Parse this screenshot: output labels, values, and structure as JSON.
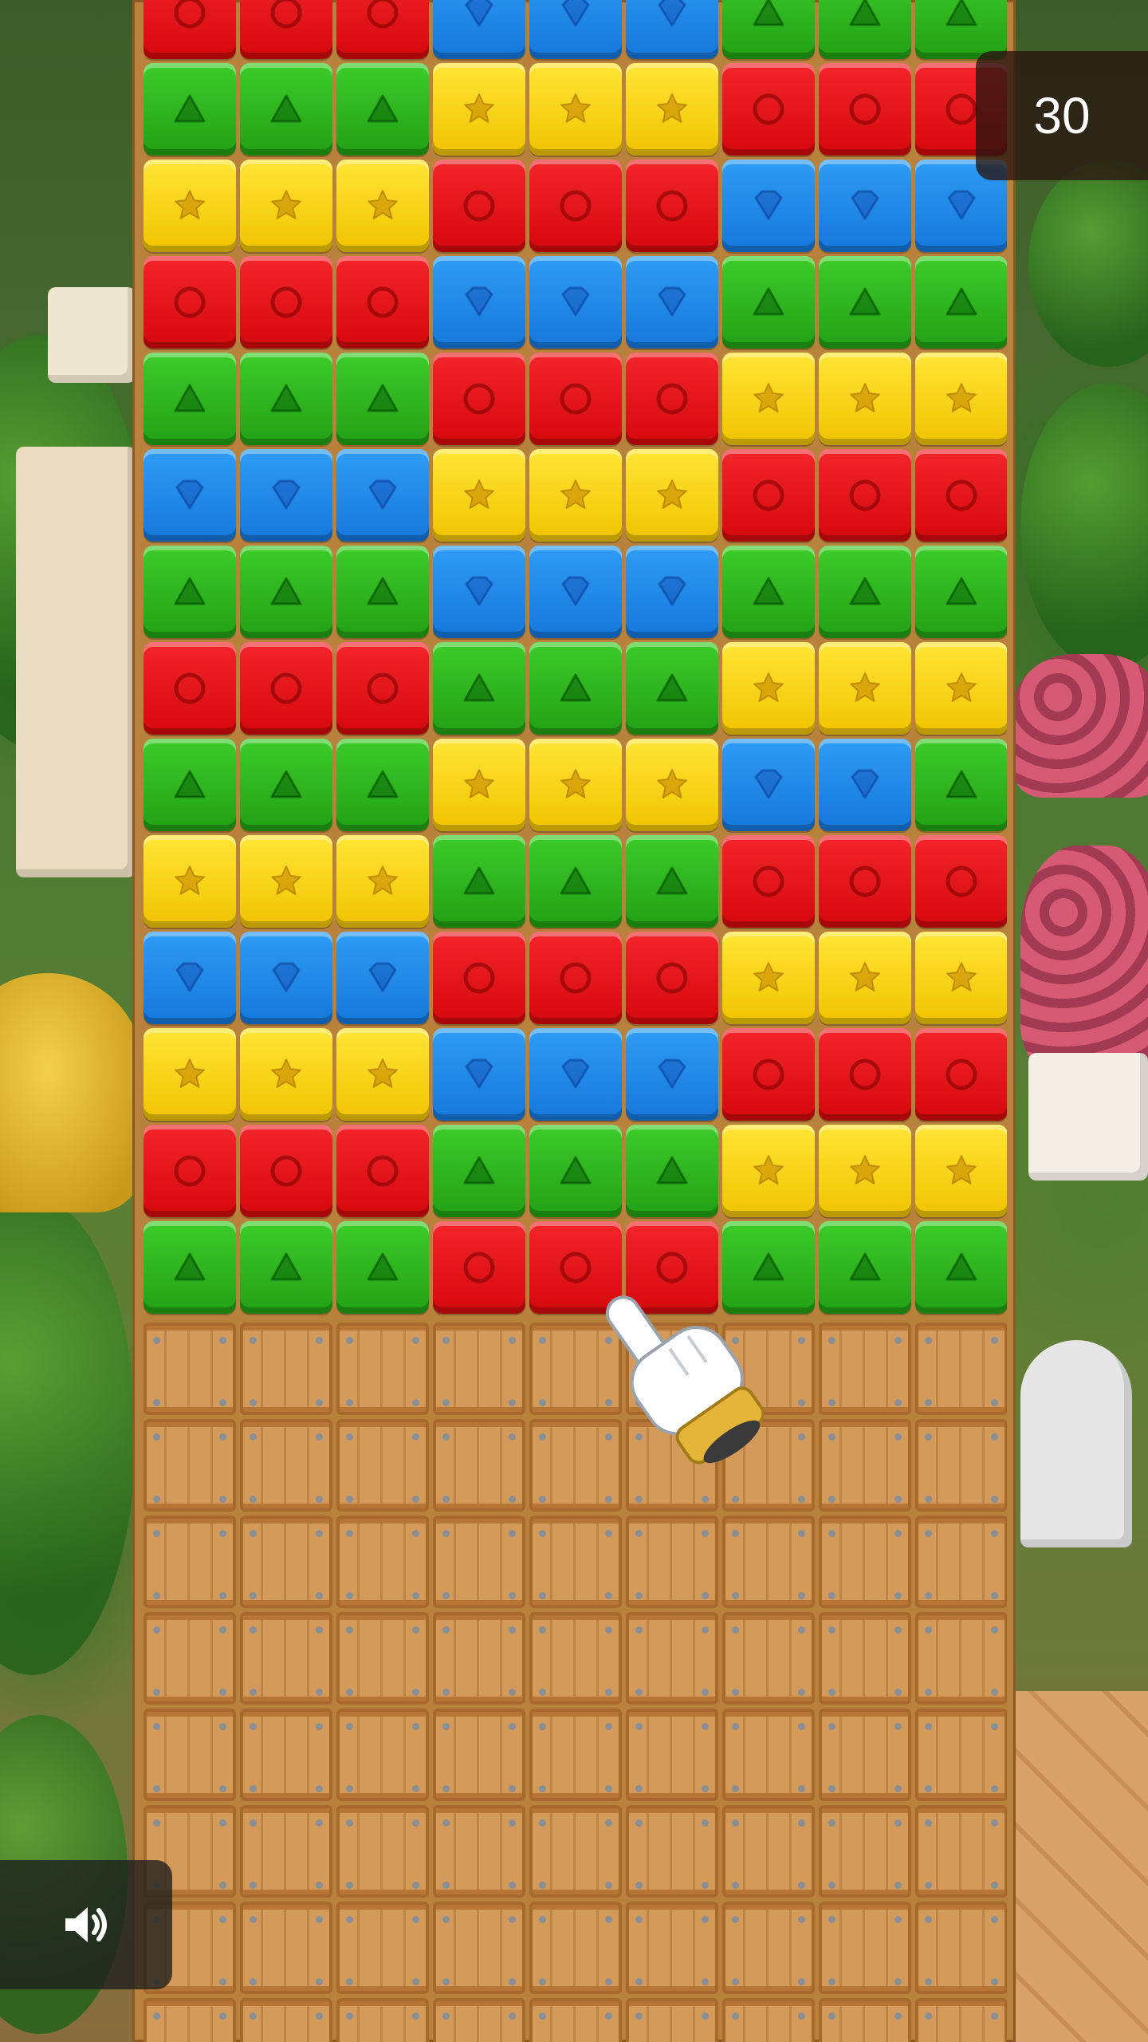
{
  "game": {
    "moves_left": "30",
    "sound_icon": "speaker-on-icon",
    "tutorial_icon": "pointing-hand-icon",
    "colors": {
      "red": "#e01519",
      "green": "#2fb51f",
      "yellow": "#fbd515",
      "blue": "#2186e8"
    },
    "symbols": {
      "red": "circle",
      "green": "triangle",
      "yellow": "star",
      "blue": "diamond"
    }
  },
  "board": {
    "columns": 9,
    "cube_rows": [
      [
        "R",
        "R",
        "R",
        "B",
        "B",
        "B",
        "G",
        "G",
        "G"
      ],
      [
        "G",
        "G",
        "G",
        "Y",
        "Y",
        "Y",
        "R",
        "R",
        "R"
      ],
      [
        "Y",
        "Y",
        "Y",
        "R",
        "R",
        "R",
        "B",
        "B",
        "B"
      ],
      [
        "R",
        "R",
        "R",
        "B",
        "B",
        "B",
        "G",
        "G",
        "G"
      ],
      [
        "G",
        "G",
        "G",
        "R",
        "R",
        "R",
        "Y",
        "Y",
        "Y"
      ],
      [
        "B",
        "B",
        "B",
        "Y",
        "Y",
        "Y",
        "R",
        "R",
        "R"
      ],
      [
        "G",
        "G",
        "G",
        "B",
        "B",
        "B",
        "G",
        "G",
        "G"
      ],
      [
        "R",
        "R",
        "R",
        "G",
        "G",
        "G",
        "Y",
        "Y",
        "Y"
      ],
      [
        "G",
        "G",
        "G",
        "Y",
        "Y",
        "Y",
        "B",
        "B",
        "G"
      ],
      [
        "Y",
        "Y",
        "Y",
        "G",
        "G",
        "G",
        "R",
        "R",
        "R"
      ],
      [
        "B",
        "B",
        "B",
        "R",
        "R",
        "R",
        "Y",
        "Y",
        "Y"
      ],
      [
        "Y",
        "Y",
        "Y",
        "B",
        "B",
        "B",
        "R",
        "R",
        "R"
      ],
      [
        "R",
        "R",
        "R",
        "G",
        "G",
        "G",
        "Y",
        "Y",
        "Y"
      ],
      [
        "G",
        "G",
        "G",
        "R",
        "R",
        "R",
        "G",
        "G",
        "G"
      ]
    ],
    "crate_rows": 8
  }
}
